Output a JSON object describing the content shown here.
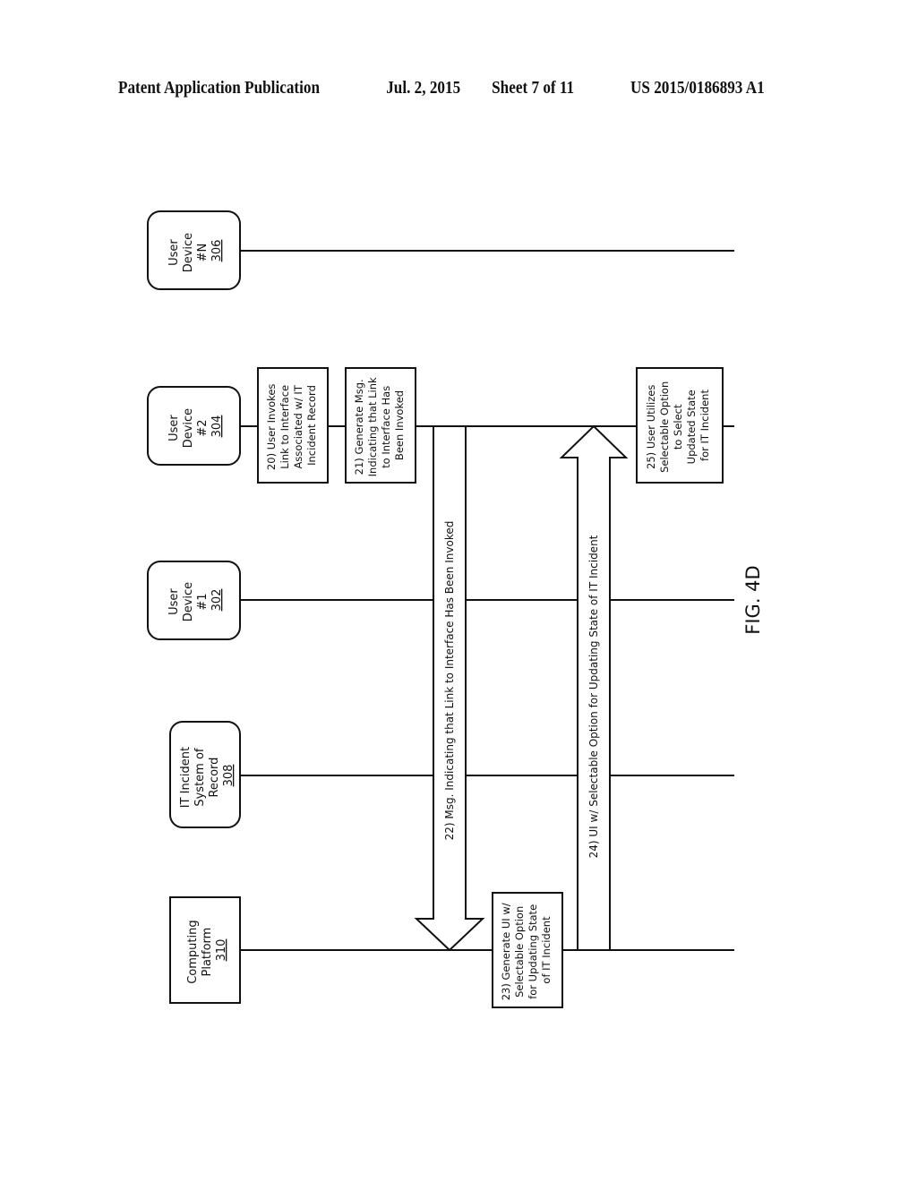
{
  "header": {
    "left": "Patent Application Publication",
    "date": "Jul. 2, 2015",
    "sheet": "Sheet 7 of 11",
    "number": "US 2015/0186893 A1"
  },
  "figure": {
    "label": "FIG. 4D",
    "entities": [
      {
        "id": "computing-platform",
        "lines": [
          "Computing",
          "Platform"
        ],
        "ref": "310",
        "shape": "rectangle"
      },
      {
        "id": "it-incident-system",
        "lines": [
          "IT Incident",
          "System of",
          "Record"
        ],
        "ref": "308",
        "shape": "rounded"
      },
      {
        "id": "user-device-1",
        "lines": [
          "User",
          "Device",
          "#1"
        ],
        "ref": "302",
        "shape": "rounded"
      },
      {
        "id": "user-device-2",
        "lines": [
          "User",
          "Device",
          "#2"
        ],
        "ref": "304",
        "shape": "rounded"
      },
      {
        "id": "user-device-n",
        "lines": [
          "User",
          "Device",
          "#N"
        ],
        "ref": "306",
        "shape": "rounded"
      }
    ],
    "steps": [
      {
        "id": "step-20",
        "lines": [
          "20) User Invokes",
          "Link to Interface",
          "Associated w/ IT",
          "Incident Record"
        ],
        "actor": "user-device-2"
      },
      {
        "id": "step-21",
        "lines": [
          "21) Generate Msg.",
          "Indicating that Link",
          "to Interface Has",
          "Been Invoked"
        ],
        "actor": "user-device-2"
      },
      {
        "id": "step-23",
        "lines": [
          "23) Generate UI w/",
          "Selectable Option",
          "for Updating State",
          "of IT Incident"
        ],
        "actor": "computing-platform"
      },
      {
        "id": "step-25",
        "lines": [
          "25) User Utilizes",
          "Selectable Option",
          "to Select",
          "Updated State",
          "for IT Incident"
        ],
        "actor": "user-device-2"
      }
    ],
    "messages": [
      {
        "id": "msg-22",
        "text": "22) Msg. Indicating that Link to Interface Has Been Invoked",
        "from": "user-device-2",
        "to": "computing-platform"
      },
      {
        "id": "msg-24",
        "text": "24) UI w/ Selectable Option for Updating State of IT Incident",
        "from": "computing-platform",
        "to": "user-device-2"
      }
    ]
  }
}
